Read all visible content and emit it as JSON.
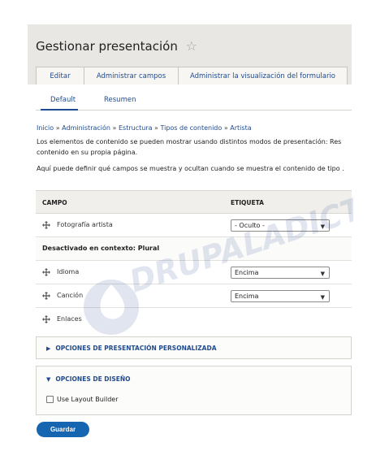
{
  "page": {
    "title": "Gestionar presentación",
    "favorite_icon": "star-outline-icon"
  },
  "tabs": [
    {
      "label": "Editar"
    },
    {
      "label": "Administrar campos"
    },
    {
      "label": "Administrar la visualización del formulario"
    }
  ],
  "subtabs": [
    {
      "label": "Default",
      "active": true
    },
    {
      "label": "Resumen",
      "active": false
    }
  ],
  "breadcrumb": {
    "items": [
      "Inicio",
      "Administración",
      "Estructura",
      "Tipos de contenido",
      "Artista"
    ],
    "separator": "»"
  },
  "description": {
    "line1": "Los elementos de contenido se pueden mostrar usando distintos modos de presentación: Res",
    "line2": "contenido en su propia página.",
    "line3": "Aquí puede definir qué campos se muestra y ocultan cuando se muestra el contenido de tipo ."
  },
  "table": {
    "headers": {
      "campo": "CAMPO",
      "etiqueta": "ETIQUETA"
    },
    "rows": [
      {
        "type": "field",
        "name": "Fotografía artista",
        "label": "- Oculto -"
      },
      {
        "type": "region",
        "name": "Desactivado en contexto: Plural"
      },
      {
        "type": "field",
        "name": "Idioma",
        "label": "Encima"
      },
      {
        "type": "field",
        "name": "Canción",
        "label": "Encima"
      },
      {
        "type": "field",
        "name": "Enlaces",
        "label": ""
      }
    ]
  },
  "custom_display": {
    "summary": "OPCIONES DE PRESENTACIÓN PERSONALIZADA",
    "expanded": false
  },
  "layout_options": {
    "summary": "OPCIONES DE DISEÑO",
    "expanded": true,
    "checkbox_label": "Use Layout Builder",
    "checked": false
  },
  "save_button": {
    "label": "Guardar"
  },
  "watermark": {
    "text": "DRUPALADICTO"
  },
  "colors": {
    "link": "#1f4a8f",
    "primary": "#1565b0",
    "header_bg": "#e8e7e3"
  }
}
